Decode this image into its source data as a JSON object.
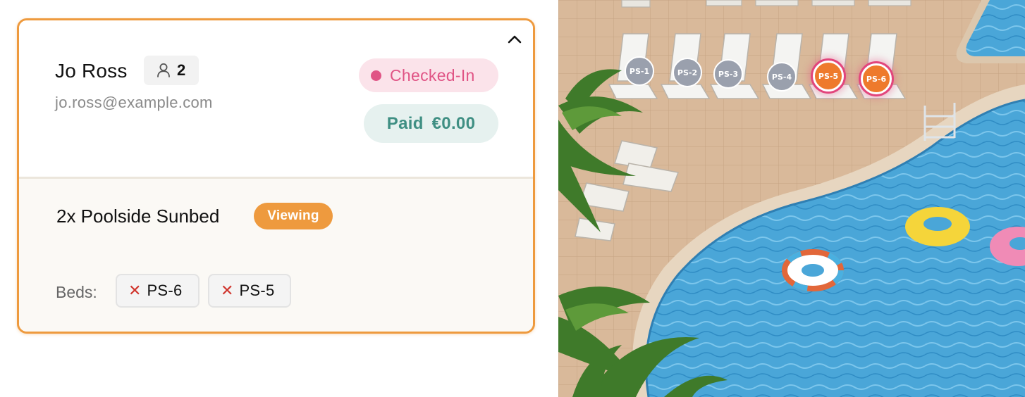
{
  "booking": {
    "guest_name": "Jo Ross",
    "guest_count": "2",
    "email": "jo.ross@example.com",
    "status": "Checked-In",
    "payment_status": "Paid",
    "payment_amount": "€0.00",
    "product": "2x Poolside Sunbed",
    "product_badge": "Viewing",
    "beds_label": "Beds:",
    "beds": [
      "PS-6",
      "PS-5"
    ]
  },
  "map": {
    "markers": [
      {
        "label": "PS-1",
        "state": "available"
      },
      {
        "label": "PS-2",
        "state": "available"
      },
      {
        "label": "PS-3",
        "state": "available"
      },
      {
        "label": "PS-4",
        "state": "available"
      },
      {
        "label": "PS-5",
        "state": "selected"
      },
      {
        "label": "PS-6",
        "state": "selected"
      }
    ]
  },
  "colors": {
    "accent": "#ee9a3e",
    "checked_in": "#e05485",
    "paid": "#3f8f83",
    "marker_available": "#9aa0ad",
    "marker_selected": "#ee7a2c"
  },
  "icons": {
    "collapse": "chevron-up-icon",
    "guests": "person-icon",
    "remove": "close-icon"
  }
}
